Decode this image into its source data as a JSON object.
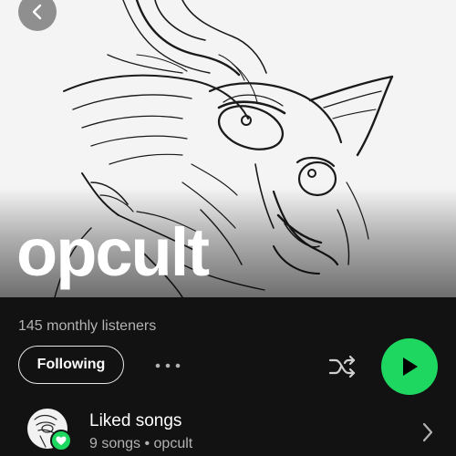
{
  "artist": {
    "name": "opcult",
    "monthly_listeners": "145 monthly listeners"
  },
  "actions": {
    "follow_label": "Following",
    "more_icon": "more-horizontal-icon",
    "shuffle_icon": "shuffle-icon",
    "play_icon": "play-icon"
  },
  "nav": {
    "back_icon": "chevron-left-icon"
  },
  "liked": {
    "title": "Liked songs",
    "subtitle": "9 songs • opcult",
    "badge_icon": "heart-icon",
    "chevron_icon": "chevron-right-icon"
  },
  "colors": {
    "background": "#121212",
    "accent": "#1ed760",
    "secondary_text": "#b3b3b3",
    "primary_text": "#ffffff"
  }
}
